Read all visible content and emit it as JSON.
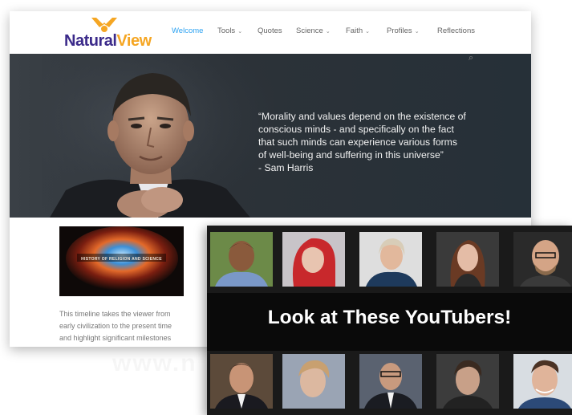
{
  "site": {
    "logo": {
      "part1": "Natural",
      "part2": "View"
    },
    "nav": [
      {
        "label": "Welcome",
        "active": true
      },
      {
        "label": "Tools",
        "dropdown": true
      },
      {
        "label": "Quotes"
      },
      {
        "label": "Science",
        "dropdown": true
      },
      {
        "label": "Faith",
        "dropdown": true
      },
      {
        "label": "Profiles",
        "dropdown": true
      },
      {
        "label": "Reflections"
      }
    ],
    "hero": {
      "quote_lines": [
        "“Morality and values depend on the existence of",
        "conscious minds - and specifically on the fact",
        "that such minds can experience various forms",
        "of well-being and suffering in this universe”",
        "- Sam Harris"
      ]
    },
    "video": {
      "title": "HISTORY OF RELIGION AND SCIENCE"
    },
    "timeline_lines": [
      "This timeline takes the viewer from",
      "early civilization to the present time",
      "and highlight significant milestones"
    ],
    "watermark": "www.n"
  },
  "youtubers": {
    "headline": "Look at These YouTubers!"
  },
  "colors": {
    "logo_primary": "#3b2a8a",
    "logo_accent": "#f5a623",
    "nav_active": "#2ea3f2",
    "hero_bg": "#2c3238"
  },
  "icons": {
    "search": "search-icon",
    "chevron": "chevron-down-icon",
    "logo_mark": "person-arms-up-icon"
  }
}
